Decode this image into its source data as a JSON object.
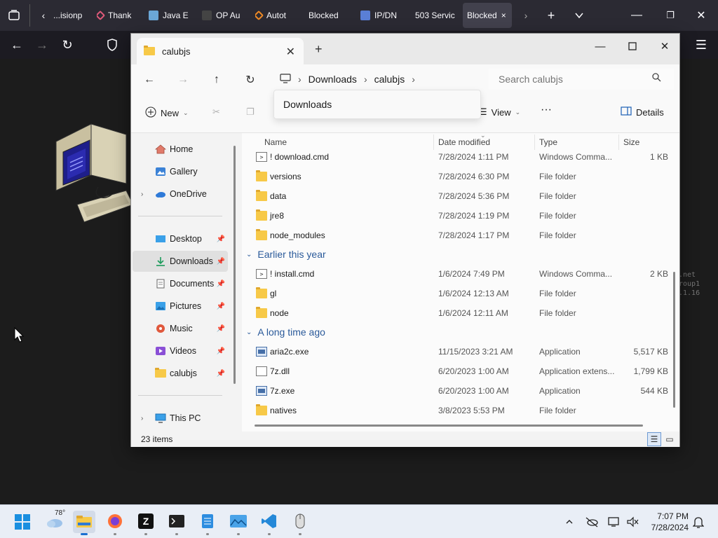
{
  "browser": {
    "tabs": [
      {
        "label": "...isionp",
        "color": "#aaaaaa"
      },
      {
        "label": "Thank",
        "color": "#e05a7a"
      },
      {
        "label": "Java E",
        "color": "#6ba7d6"
      },
      {
        "label": "OP Au",
        "color": "#444444"
      },
      {
        "label": "Autot",
        "color": "#f08a24"
      },
      {
        "label": "Blocked",
        "color": ""
      },
      {
        "label": "IP/DN",
        "color": "#5a7fd6"
      },
      {
        "label": "503 Servic",
        "color": ""
      },
      {
        "label": "Blocked",
        "color": "",
        "active": true
      }
    ],
    "tab_close": "×"
  },
  "explorer": {
    "tab_title": "calubjs",
    "breadcrumb": [
      "Downloads",
      "calubjs"
    ],
    "breadcrumb_dropdown_item": "Downloads",
    "search_placeholder": "Search calubjs",
    "commands": {
      "new_label": "New",
      "view_label": "View",
      "details_label": "Details",
      "more": "···"
    },
    "nav_items": [
      {
        "label": "Home",
        "icon": "home-icon"
      },
      {
        "label": "Gallery",
        "icon": "gallery-icon"
      },
      {
        "label": "OneDrive",
        "icon": "onedrive-icon",
        "expandable": true
      },
      {
        "label": "Desktop",
        "icon": "desktop-icon",
        "pinned": true
      },
      {
        "label": "Downloads",
        "icon": "downloads-icon",
        "pinned": true,
        "selected": true
      },
      {
        "label": "Documents",
        "icon": "documents-icon",
        "pinned": true
      },
      {
        "label": "Pictures",
        "icon": "pictures-icon",
        "pinned": true
      },
      {
        "label": "Music",
        "icon": "music-icon",
        "pinned": true
      },
      {
        "label": "Videos",
        "icon": "videos-icon",
        "pinned": true
      },
      {
        "label": "calubjs",
        "icon": "folder-icon",
        "pinned": true
      },
      {
        "label": "This PC",
        "icon": "this-pc-icon",
        "expandable": true
      }
    ],
    "columns": {
      "name": "Name",
      "date": "Date modified",
      "type": "Type",
      "size": "Size"
    },
    "group_earlier": "Earlier this year",
    "group_long_ago": "A long time ago",
    "files_recent": [
      {
        "name": "! download.cmd",
        "date": "7/28/2024 1:11 PM",
        "type": "Windows Comma...",
        "size": "1 KB",
        "icon": "cmd-file-icon"
      },
      {
        "name": "versions",
        "date": "7/28/2024 6:30 PM",
        "type": "File folder",
        "size": "",
        "icon": "folder-icon"
      },
      {
        "name": "data",
        "date": "7/28/2024 5:36 PM",
        "type": "File folder",
        "size": "",
        "icon": "folder-icon"
      },
      {
        "name": "jre8",
        "date": "7/28/2024 1:19 PM",
        "type": "File folder",
        "size": "",
        "icon": "folder-icon"
      },
      {
        "name": "node_modules",
        "date": "7/28/2024 1:17 PM",
        "type": "File folder",
        "size": "",
        "icon": "folder-icon"
      }
    ],
    "files_earlier": [
      {
        "name": "! install.cmd",
        "date": "1/6/2024 7:49 PM",
        "type": "Windows Comma...",
        "size": "2 KB",
        "icon": "cmd-file-icon"
      },
      {
        "name": "gl",
        "date": "1/6/2024 12:13 AM",
        "type": "File folder",
        "size": "",
        "icon": "folder-icon"
      },
      {
        "name": "node",
        "date": "1/6/2024 12:11 AM",
        "type": "File folder",
        "size": "",
        "icon": "folder-icon"
      }
    ],
    "files_long_ago": [
      {
        "name": "aria2c.exe",
        "date": "11/15/2023 3:21 AM",
        "type": "Application",
        "size": "5,517 KB",
        "icon": "exe-file-icon"
      },
      {
        "name": "7z.dll",
        "date": "6/20/2023 1:00 AM",
        "type": "Application extens...",
        "size": "1,799 KB",
        "icon": "dll-file-icon"
      },
      {
        "name": "7z.exe",
        "date": "6/20/2023 1:00 AM",
        "type": "Application",
        "size": "544 KB",
        "icon": "exe-file-icon"
      },
      {
        "name": "natives",
        "date": "3/8/2023 5:53 PM",
        "type": "File folder",
        "size": "",
        "icon": "folder-icon"
      }
    ],
    "status_items": "23 items"
  },
  "background_text": [
    ".net",
    "roup1",
    ".1.16"
  ],
  "taskbar": {
    "weather_temp": "78°",
    "clock_time": "7:07 PM",
    "clock_date": "7/28/2024"
  }
}
